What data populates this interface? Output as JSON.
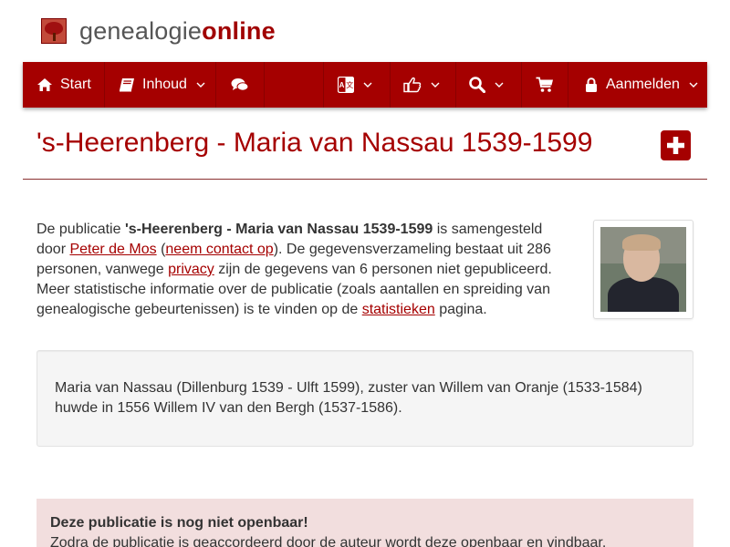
{
  "brand": {
    "name_part1": "genealogie",
    "name_part2": "online"
  },
  "nav": {
    "start_label": "Start",
    "inhoud_label": "Inhoud",
    "login_label": "Aanmelden",
    "icons": [
      "home-icon",
      "book-icon",
      "comments-icon",
      "language-icon",
      "thumbs-up-icon",
      "search-icon",
      "shopping-cart-icon",
      "lock-icon",
      "chevron-down-icon"
    ]
  },
  "page": {
    "title": "'s-Heerenberg - Maria van Nassau 1539-1599"
  },
  "intro": {
    "t1": "De publicatie ",
    "pub_name": "'s-Heerenberg - Maria van Nassau 1539-1599",
    "t2": " is samengesteld door ",
    "author_link": "Peter de Mos",
    "t3": " (",
    "contact_link": "neem contact op",
    "t4": "). De gegevensverzameling bestaat uit 286 personen, vanwege ",
    "privacy_link": "privacy",
    "t5": " zijn de gegevens van 6 personen niet gepubliceerd. Meer statistische informatie over de publicatie (zoals aantallen en spreiding van genealogische gebeurtenissen) is te vinden op de ",
    "stats_link": "statistieken",
    "t6": " pagina."
  },
  "summary": {
    "text": "Maria van Nassau (Dillenburg 1539 - Ulft 1599), zuster van Willem van Oranje (1533-1584) huwde in 1556 Willem IV van den Bergh (1537-1586)."
  },
  "alert": {
    "title": "Deze publicatie is nog niet openbaar!",
    "text": "Zodra de publicatie is geaccordeerd door de auteur wordt deze openbaar en vindbaar."
  },
  "colors": {
    "brand_red": "#a50000",
    "alert_bg": "#f2dede",
    "summary_bg": "#f5f5f5"
  }
}
